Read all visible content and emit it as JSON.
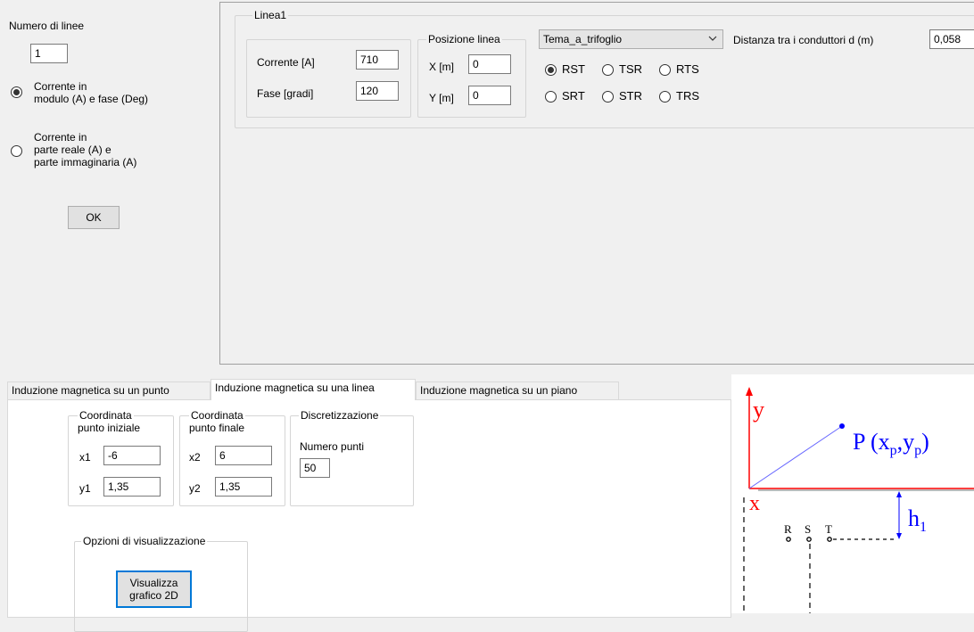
{
  "left_panel": {
    "num_lines_label": "Numero di linee",
    "num_lines_value": "1",
    "radio_mod_line1": "Corrente in",
    "radio_mod_line2": "modulo (A) e fase (Deg)",
    "radio_re_line1": "Corrente in",
    "radio_re_line2": "parte reale (A) e",
    "radio_re_line3": "parte immaginaria (A)",
    "ok_label": "OK"
  },
  "line_group": {
    "title": "Linea1",
    "current_label": "Corrente [A]",
    "current_value": "710",
    "phase_label": "Fase [gradi]",
    "phase_value": "120",
    "position_title": "Posizione linea",
    "x_label": "X [m]",
    "x_value": "0",
    "y_label": "Y [m]",
    "y_value": "0",
    "config_selected": "Tema_a_trifoglio",
    "phases": [
      "RST",
      "TSR",
      "RTS",
      "SRT",
      "STR",
      "TRS"
    ],
    "distance_label": "Distanza tra i conduttori d (m)",
    "distance_value": "0,058"
  },
  "tabs": [
    "Induzione magnetica su un punto",
    "Induzione magnetica su una linea",
    "Induzione magnetica su un piano"
  ],
  "tab_content": {
    "start_title_1": "Coordinata",
    "start_title_2": "punto iniziale",
    "x1_label": "x1",
    "x1_value": "-6",
    "y1_label": "y1",
    "y1_value": "1,35",
    "end_title_1": "Coordinata",
    "end_title_2": "punto finale",
    "x2_label": "x2",
    "x2_value": "6",
    "y2_label": "y2",
    "y2_value": "1,35",
    "disc_title": "Discretizzazione",
    "num_points_label": "Numero punti",
    "num_points_value": "50",
    "display_title": "Opzioni di visualizzazione",
    "visualize_line1": "Visualizza",
    "visualize_line2": "grafico 2D"
  },
  "diagram": {
    "y_axis": "y",
    "x_axis": "x",
    "point_label": "P (xp,yp)",
    "height_label": "h1",
    "conductors": [
      "R",
      "S",
      "T"
    ]
  },
  "colors": {
    "window_bg": "#f0f0f0",
    "axis_red": "#ff0000",
    "diagram_blue": "#0000ff",
    "button_focus": "#0078d7"
  }
}
